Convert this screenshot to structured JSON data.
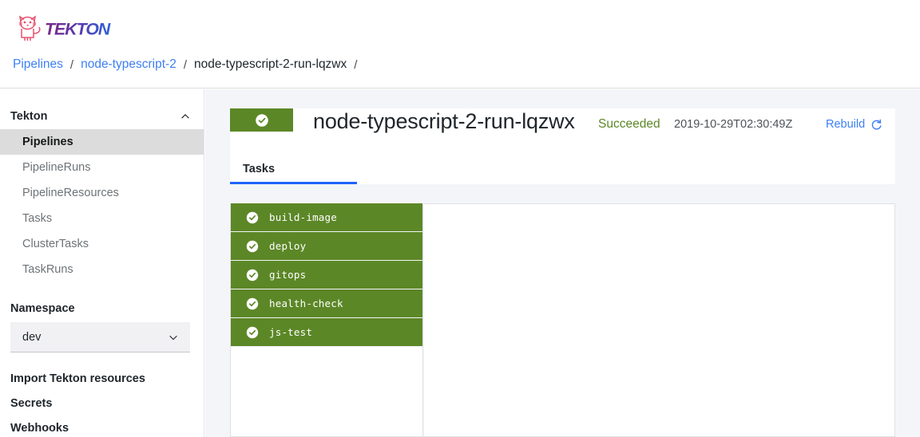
{
  "brand": {
    "name": "TEKTON",
    "logo_icon": "tekton-cat-logo",
    "colors": {
      "logo_start": "#6b2d8c",
      "logo_end": "#2b5fd9",
      "cat": "#e8526e"
    }
  },
  "breadcrumb": {
    "items": [
      {
        "label": "Pipelines",
        "link": true
      },
      {
        "label": "node-typescript-2",
        "link": true
      },
      {
        "label": "node-typescript-2-run-lqzwx",
        "link": false
      }
    ],
    "separator": "/",
    "trailing_separator": "/"
  },
  "sidebar": {
    "header": {
      "label": "Tekton",
      "icon": "chevron-up-icon"
    },
    "items": [
      {
        "label": "Pipelines",
        "selected": true
      },
      {
        "label": "PipelineRuns",
        "selected": false
      },
      {
        "label": "PipelineResources",
        "selected": false
      },
      {
        "label": "Tasks",
        "selected": false
      },
      {
        "label": "ClusterTasks",
        "selected": false
      },
      {
        "label": "TaskRuns",
        "selected": false
      }
    ],
    "namespace": {
      "label": "Namespace",
      "value": "dev",
      "icon": "chevron-down-icon"
    },
    "links": [
      {
        "label": "Import Tekton resources"
      },
      {
        "label": "Secrets"
      },
      {
        "label": "Webhooks"
      }
    ]
  },
  "run_header": {
    "status_icon": "check-circle-icon",
    "status_color": "#5c8727",
    "title": "node-typescript-2-run-lqzwx",
    "status_text": "Succeeded",
    "timestamp": "2019-10-29T02:30:49Z",
    "rebuild": {
      "label": "Rebuild",
      "icon": "restart-icon",
      "color": "#3d7ff4"
    }
  },
  "tabs": [
    {
      "label": "Tasks",
      "active": true
    }
  ],
  "tasks": [
    {
      "name": "build-image",
      "status": "succeeded",
      "icon": "check-circle-icon"
    },
    {
      "name": "deploy",
      "status": "succeeded",
      "icon": "check-circle-icon"
    },
    {
      "name": "gitops",
      "status": "succeeded",
      "icon": "check-circle-icon"
    },
    {
      "name": "health-check",
      "status": "succeeded",
      "icon": "check-circle-icon"
    },
    {
      "name": "js-test",
      "status": "succeeded",
      "icon": "check-circle-icon"
    }
  ]
}
